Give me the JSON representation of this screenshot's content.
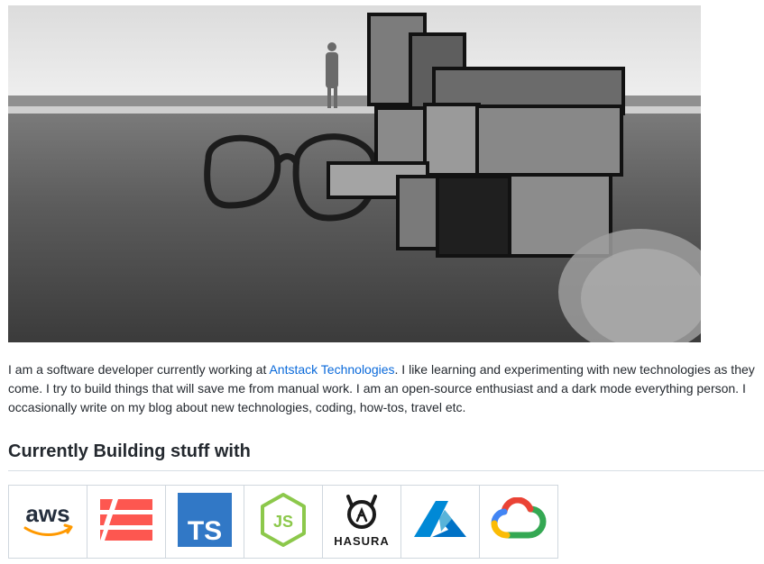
{
  "hero": {
    "alt_icon": "rubiks-cube-beach-photo"
  },
  "bio": {
    "before_link": "I am a software developer currently working at ",
    "link_text": "Antstack Technologies",
    "after_link": ". I like learning and experimenting with new technologies as they come. I try to build things that will save me from manual work. I am an open-source enthusiast and a dark mode everything person. I occasionally write on my blog about new technologies, coding, how-tos, travel etc."
  },
  "section": {
    "title": "Currently Building stuff with"
  },
  "tech": [
    {
      "icon": "aws-icon",
      "label": "aws"
    },
    {
      "icon": "serverless-icon"
    },
    {
      "icon": "typescript-icon",
      "label": "TS"
    },
    {
      "icon": "nodejs-icon",
      "label": "JS"
    },
    {
      "icon": "hasura-icon",
      "label": "HASURA"
    },
    {
      "icon": "azure-icon"
    },
    {
      "icon": "google-cloud-icon"
    }
  ],
  "colors": {
    "link": "#0969da",
    "aws_orange": "#ff9900",
    "serverless_red": "#fd5750",
    "typescript_blue": "#3178c6",
    "node_green": "#8cc84b",
    "azure_blue": "#0089d6"
  }
}
